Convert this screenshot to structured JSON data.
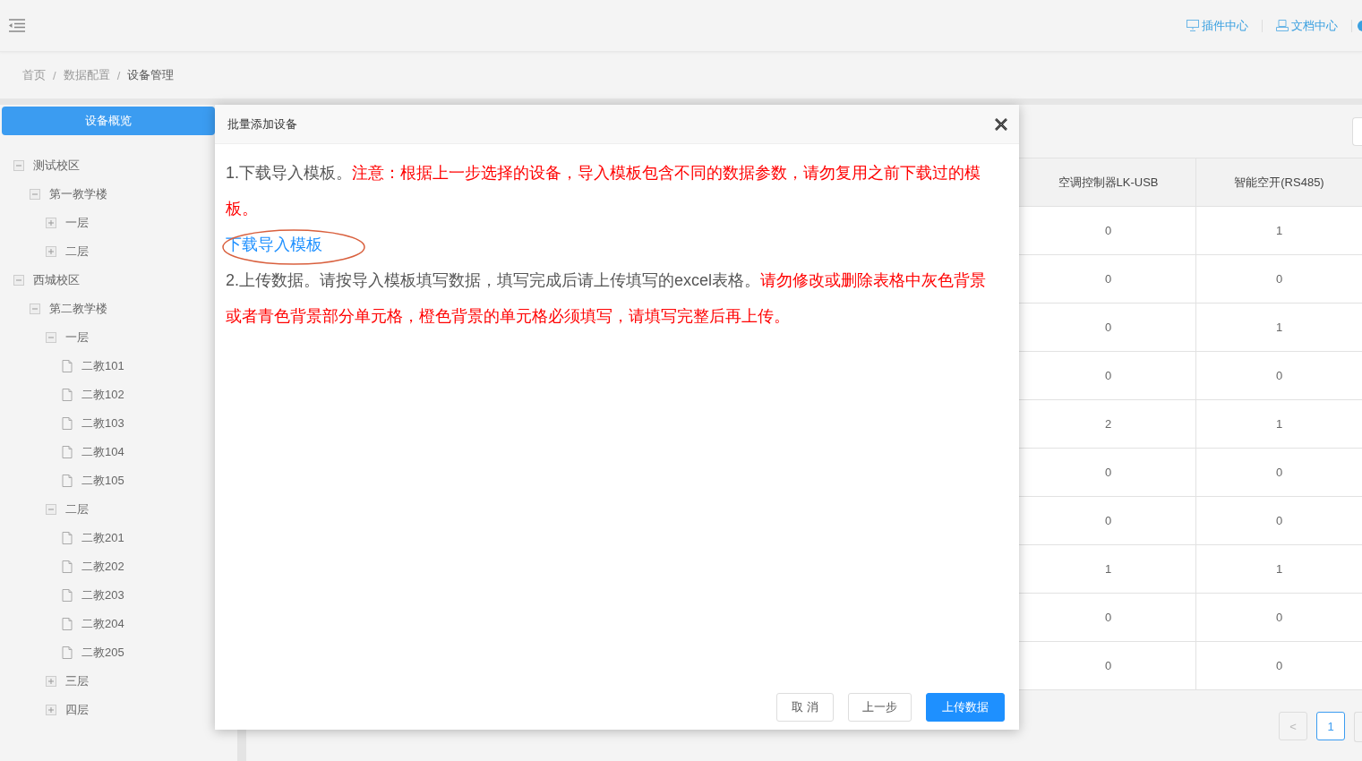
{
  "header": {
    "links": [
      {
        "label": "插件中心",
        "kind": "monitor"
      },
      {
        "label": "文档中心",
        "kind": "document"
      }
    ]
  },
  "breadcrumb": [
    {
      "label": "首页",
      "selected": false,
      "separator": "/"
    },
    {
      "label": "数据配置",
      "selected": false,
      "separator": "/"
    },
    {
      "label": "设备管理",
      "selected": true
    }
  ],
  "sidebar": {
    "button": "设备概览",
    "tree": [
      {
        "label": "测试校区",
        "expanded": true,
        "children": [
          {
            "label": "第一教学楼",
            "expanded": true,
            "children": [
              {
                "label": "一层",
                "expanded": false
              },
              {
                "label": "二层",
                "expanded": false
              }
            ]
          }
        ]
      },
      {
        "label": "西城校区",
        "expanded": true,
        "children": [
          {
            "label": "第二教学楼",
            "expanded": true,
            "children": [
              {
                "label": "一层",
                "expanded": true,
                "children": [
                  {
                    "label": "二教101",
                    "kind": "leaf"
                  },
                  {
                    "label": "二教102",
                    "kind": "leaf"
                  },
                  {
                    "label": "二教103",
                    "kind": "leaf"
                  },
                  {
                    "label": "二教104",
                    "kind": "leaf"
                  },
                  {
                    "label": "二教105",
                    "kind": "leaf"
                  }
                ]
              },
              {
                "label": "二层",
                "expanded": true,
                "children": [
                  {
                    "label": "二教201",
                    "kind": "leaf"
                  },
                  {
                    "label": "二教202",
                    "kind": "leaf"
                  },
                  {
                    "label": "二教203",
                    "kind": "leaf"
                  },
                  {
                    "label": "二教204",
                    "kind": "leaf"
                  },
                  {
                    "label": "二教205",
                    "kind": "leaf"
                  }
                ]
              },
              {
                "label": "三层",
                "expanded": false
              },
              {
                "label": "四层",
                "expanded": false
              }
            ]
          }
        ]
      }
    ]
  },
  "table": {
    "columns": [
      "空调控制器LK-USB",
      "智能空开(RS485)"
    ],
    "rows": [
      [
        "0",
        "1"
      ],
      [
        "0",
        "0"
      ],
      [
        "0",
        "1"
      ],
      [
        "0",
        "0"
      ],
      [
        "2",
        "1"
      ],
      [
        "0",
        "0"
      ],
      [
        "0",
        "0"
      ],
      [
        "1",
        "1"
      ],
      [
        "0",
        "0"
      ],
      [
        "0",
        "0"
      ]
    ]
  },
  "pagination": [
    {
      "label": "<",
      "selected": false
    },
    {
      "label": "1",
      "selected": true
    }
  ],
  "dialog": {
    "title": "批量添加设备",
    "paragraphs": [
      {
        "kind": "text",
        "parts": [
          {
            "text": "1.下载导入模板。",
            "warning": false
          },
          {
            "text": "注意：根据上一步选择的设备，导入模板包含不同的数据参数，请勿复用之前下载过的模板。",
            "warning": true
          }
        ]
      },
      {
        "kind": "link",
        "text": "下载导入模板",
        "circled": true
      },
      {
        "kind": "text",
        "parts": [
          {
            "text": "2.上传数据。请按导入模板填写数据，填写完成后请上传填写的excel表格。",
            "warning": false
          },
          {
            "text": "请勿修改或删除表格中灰色背景或者青色背景部分单元格，橙色背景的单元格必须填写，请填写完整后再上传。",
            "warning": true
          }
        ]
      }
    ],
    "buttons": [
      {
        "label": "取 消",
        "kind": "default"
      },
      {
        "label": "上一步",
        "kind": "default"
      },
      {
        "label": "上传数据",
        "kind": "primary"
      }
    ]
  }
}
